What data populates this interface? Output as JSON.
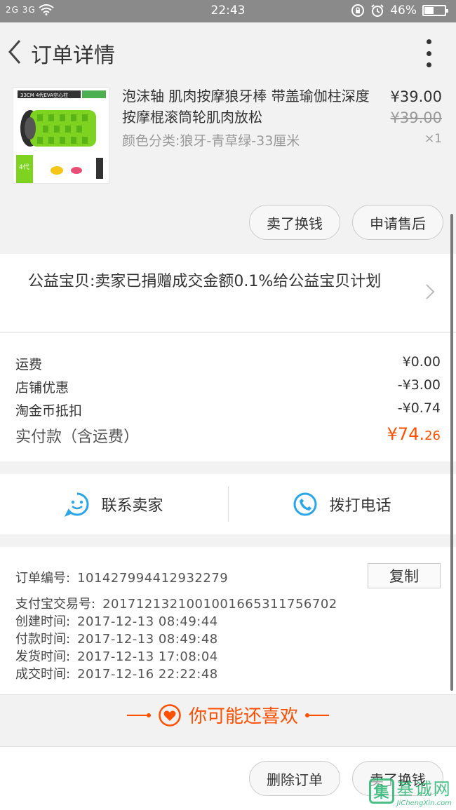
{
  "status_bar": {
    "signal_left": "2G 3G",
    "time": "22:43",
    "battery": "46%",
    "battery_level": 0.46
  },
  "nav": {
    "title": "订单详情"
  },
  "product": {
    "title": "泡沫轴 肌肉按摩狼牙棒 带盖瑜伽柱深度按摩棍滚筒轮肌肉放松",
    "spec": "颜色分类:狼牙-青草绿-33厘米",
    "price": "¥39.00",
    "original_price": "¥39.00",
    "quantity": "×1",
    "thumb_caption": "33CM 4代EVA空心柱",
    "thumb_badge": "4代"
  },
  "actions": {
    "sell_label": "卖了换钱",
    "after_sale_label": "申请售后"
  },
  "charity": {
    "text": "公益宝贝:卖家已捐赠成交金额0.1%给公益宝贝计划"
  },
  "costs": {
    "rows": [
      {
        "label": "运费",
        "value": "¥0.00"
      },
      {
        "label": "店铺优惠",
        "value": "-¥3.00"
      },
      {
        "label": "淘金币抵扣",
        "value": "-¥0.74"
      }
    ],
    "total_label": "实付款（含运费）",
    "total_currency": "¥",
    "total_int": "74.",
    "total_dec": "26"
  },
  "contact": {
    "seller_label": "联系卖家",
    "call_label": "拨打电话"
  },
  "order_info": {
    "copy_label": "复制",
    "rows": [
      {
        "label": "订单编号:",
        "value": "101427994412932279"
      },
      {
        "label": "支付宝交易号:",
        "value": "2017121321001001665311756702"
      },
      {
        "label": "创建时间:",
        "value": "2017-12-13 08:49:44"
      },
      {
        "label": "付款时间:",
        "value": "2017-12-13 08:49:48"
      },
      {
        "label": "发货时间:",
        "value": "2017-12-13 17:08:04"
      },
      {
        "label": "成交时间:",
        "value": "2017-12-16 22:22:48"
      }
    ]
  },
  "recommend": {
    "label": "你可能还喜欢"
  },
  "bottom": {
    "delete_label": "删除订单",
    "sell_label": "卖了换钱"
  },
  "watermark": {
    "cn": "基诚网",
    "en": "JiChengXin.com"
  },
  "colors": {
    "accent": "#ff5000",
    "icon_blue": "#2aa5e8"
  }
}
